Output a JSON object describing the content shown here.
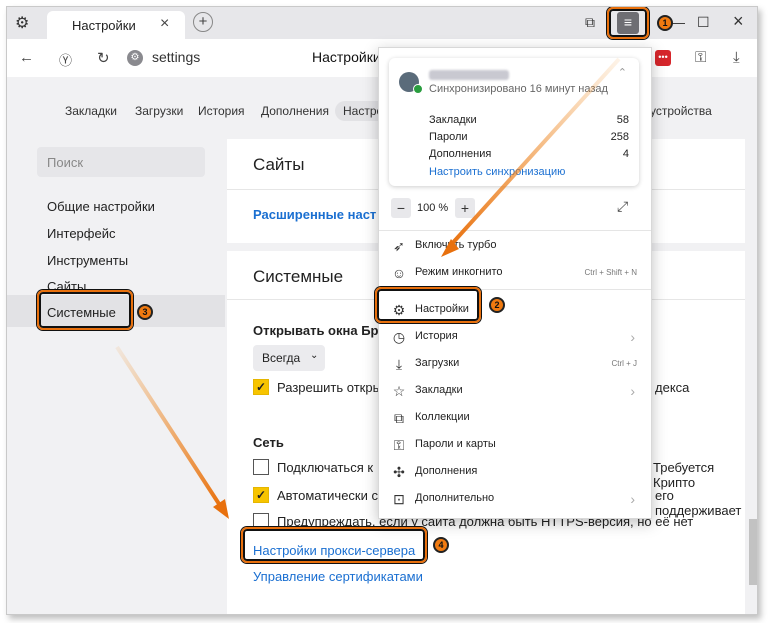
{
  "window": {
    "tab_title": "Настройки",
    "tab_close": "×",
    "new_tab": "+",
    "ctrl_minimize": "—",
    "ctrl_maximize": "☐",
    "ctrl_close": "×"
  },
  "address": {
    "url": "settings",
    "page_title": "Настройки"
  },
  "nav_tabs": [
    "Закладки",
    "Загрузки",
    "История",
    "Дополнения",
    "Настройки",
    "устройства"
  ],
  "sidebar": {
    "search_placeholder": "Поиск",
    "items": [
      "Общие настройки",
      "Интерфейс",
      "Инструменты",
      "Сайты",
      "Системные"
    ]
  },
  "main": {
    "sites_title": "Сайты",
    "sites_link": "Расширенные наст",
    "system_title": "Системные",
    "open_windows_label": "Открывать окна Бр",
    "open_windows_value": "Всегда",
    "allow_label": "Разрешить откры",
    "allow_tail": "декса",
    "network_title": "Сеть",
    "net_item1": "Подключаться к",
    "net_item1_tail": "Требуется Крипто",
    "net_item2": "Автоматически с",
    "net_item2_tail": "его поддерживает",
    "net_item3": "Предупреждать, если у сайта должна быть HTTPS-версия, но её нет",
    "proxy_link": "Настройки прокси-сервера",
    "certs_link": "Управление сертификатами"
  },
  "menu": {
    "sync_status": "Синхронизировано 16 минут назад",
    "sync_rows": [
      {
        "label": "Закладки",
        "value": "58"
      },
      {
        "label": "Пароли",
        "value": "258"
      },
      {
        "label": "Дополнения",
        "value": "4"
      }
    ],
    "sync_link": "Настроить синхронизацию",
    "zoom_minus": "−",
    "zoom_value": "100 %",
    "zoom_plus": "+",
    "items": [
      {
        "label": "Включить турбо",
        "shortcut": "",
        "arrow": ""
      },
      {
        "label": "Режим инкогнито",
        "shortcut": "Ctrl + Shift + N",
        "arrow": ""
      },
      {
        "label": "Настройки",
        "shortcut": "",
        "arrow": ""
      },
      {
        "label": "История",
        "shortcut": "",
        "arrow": "›"
      },
      {
        "label": "Загрузки",
        "shortcut": "Ctrl + J",
        "arrow": ""
      },
      {
        "label": "Закладки",
        "shortcut": "",
        "arrow": "›"
      },
      {
        "label": "Коллекции",
        "shortcut": "",
        "arrow": ""
      },
      {
        "label": "Пароли и карты",
        "shortcut": "",
        "arrow": ""
      },
      {
        "label": "Дополнения",
        "shortcut": "",
        "arrow": ""
      },
      {
        "label": "Дополнительно",
        "shortcut": "",
        "arrow": "›"
      }
    ]
  },
  "badges": [
    "1",
    "2",
    "3",
    "4"
  ],
  "colors": {
    "accent": "#e8700d",
    "link": "#1a6fd1",
    "check": "#f7c400"
  }
}
